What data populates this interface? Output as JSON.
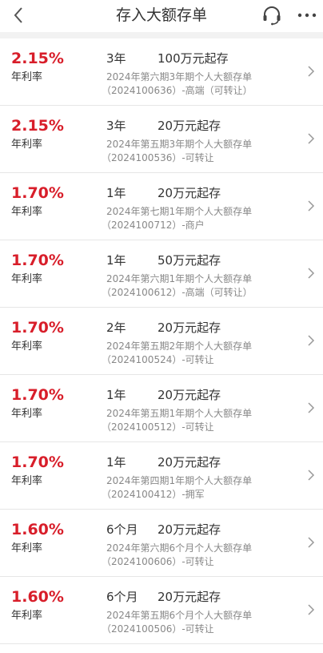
{
  "header": {
    "title": "存入大额存单",
    "icons": {
      "back": "chevron-left-icon",
      "support": "headset-icon",
      "more": "more-dots-icon"
    }
  },
  "colors": {
    "rate": "#d81e2a",
    "text": "#333333",
    "subtext": "#888888"
  },
  "products": [
    {
      "rate": "2.15%",
      "rate_label": "年利率",
      "term": "3年",
      "min": "100万元起存",
      "name": "2024年第六期3年期个人大额存单",
      "code": "（2024100636）-高端（可转让）"
    },
    {
      "rate": "2.15%",
      "rate_label": "年利率",
      "term": "3年",
      "min": "20万元起存",
      "name": "2024年第五期3年期个人大额存单",
      "code": "（2024100536）-可转让"
    },
    {
      "rate": "1.70%",
      "rate_label": "年利率",
      "term": "1年",
      "min": "20万元起存",
      "name": "2024年第七期1年期个人大额存单",
      "code": "（2024100712）-商户"
    },
    {
      "rate": "1.70%",
      "rate_label": "年利率",
      "term": "1年",
      "min": "50万元起存",
      "name": "2024年第六期1年期个人大额存单",
      "code": "（2024100612）-高端（可转让）"
    },
    {
      "rate": "1.70%",
      "rate_label": "年利率",
      "term": "2年",
      "min": "20万元起存",
      "name": "2024年第五期2年期个人大额存单",
      "code": "（2024100524）-可转让"
    },
    {
      "rate": "1.70%",
      "rate_label": "年利率",
      "term": "1年",
      "min": "20万元起存",
      "name": "2024年第五期1年期个人大额存单",
      "code": "（2024100512）-可转让"
    },
    {
      "rate": "1.70%",
      "rate_label": "年利率",
      "term": "1年",
      "min": "20万元起存",
      "name": "2024年第四期1年期个人大额存单",
      "code": "（2024100412）-拥军"
    },
    {
      "rate": "1.60%",
      "rate_label": "年利率",
      "term": "6个月",
      "min": "20万元起存",
      "name": "2024年第六期6个月个人大额存单",
      "code": "（2024100606）-可转让"
    },
    {
      "rate": "1.60%",
      "rate_label": "年利率",
      "term": "6个月",
      "min": "20万元起存",
      "name": "2024年第五期6个月个人大额存单",
      "code": "（2024100506）-可转让"
    }
  ]
}
